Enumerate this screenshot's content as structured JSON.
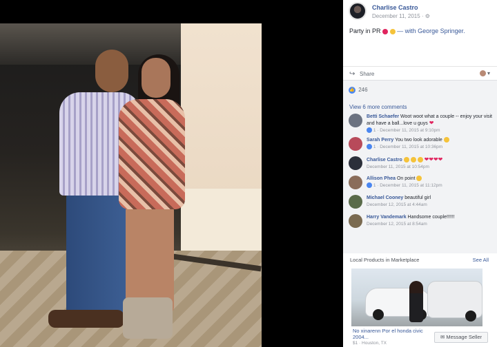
{
  "post": {
    "author": "Charlise Castro",
    "time": "December 11, 2015 · ⚙",
    "text": "Party in PR",
    "tagged": "— with George Springer."
  },
  "actions": {
    "share_label": "Share"
  },
  "reactions": {
    "count": "246"
  },
  "comments_section": {
    "view_more": "View 6 more comments",
    "items": [
      {
        "name": "Betti Schaefer",
        "text": "Woot woot what a couple -- enjoy your visit and have a ball...love u guys",
        "meta": "1 · December 11, 2015 at 9:10pm",
        "avatar_color": "#6b7280"
      },
      {
        "name": "Sarah Perry",
        "text": "You two look adorable",
        "meta": "1 · December 11, 2015 at 10:36pm",
        "avatar_color": "#b84a5a"
      },
      {
        "name": "Charlise Castro",
        "text": "",
        "meta": "December 11, 2015 at 10:54pm",
        "avatar_color": "#2b2f3a"
      },
      {
        "name": "Allison Phea",
        "text": "On point",
        "meta": "1 · December 11, 2015 at 11:12pm",
        "avatar_color": "#8a6d5a"
      },
      {
        "name": "Michael Cooney",
        "text": "beautiful girl",
        "meta": "December 12, 2015 at 4:44am",
        "avatar_color": "#5a6b4a"
      },
      {
        "name": "Harry Vandemark",
        "text": "Handsome couple!!!!!!",
        "meta": "December 12, 2015 at 8:54am",
        "avatar_color": "#7a6a50"
      }
    ]
  },
  "marketplace": {
    "title": "Local Products in Marketplace",
    "see_all": "See All",
    "listing_title": "No xinarenn Por el honda civic 2004...",
    "listing_location": "$1 · Houston, TX",
    "message_button": "Message Seller"
  },
  "colors": {
    "link": "#385898",
    "like_blue": "#4a86f0",
    "panel_bg": "#f2f3f5"
  }
}
